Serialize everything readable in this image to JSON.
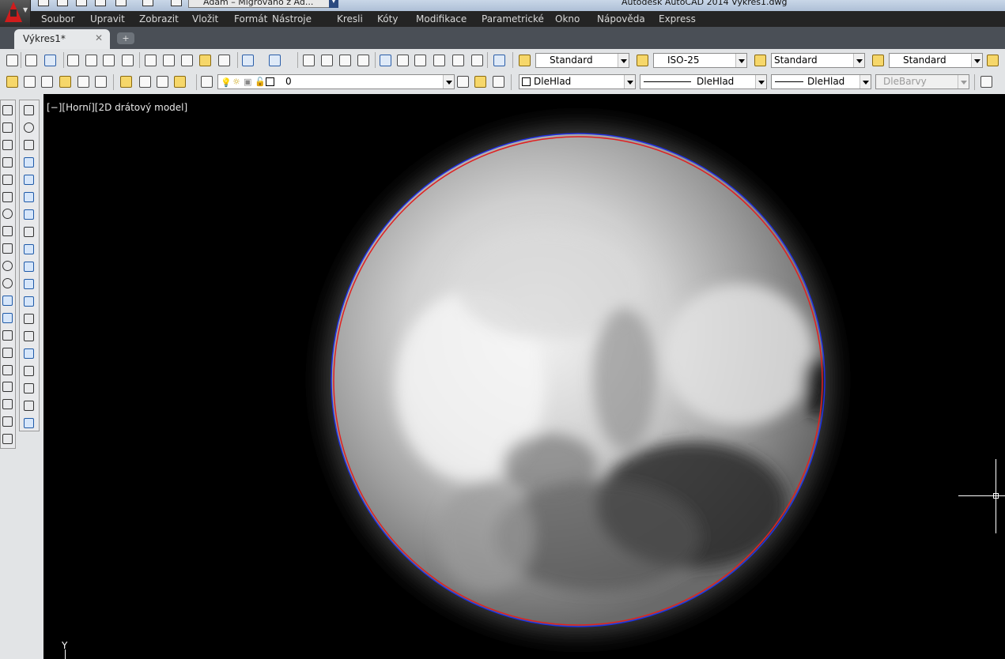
{
  "window": {
    "title": "Autodesk AutoCAD 2014   Výkres1.dwg",
    "workspace": "Adam – Migrováno z Ad..."
  },
  "menu": [
    "Soubor",
    "Upravit",
    "Zobrazit",
    "Vložit",
    "Formát",
    "Nástroje",
    "Kresli",
    "Kóty",
    "Modifikace",
    "Parametrické",
    "Okno",
    "Nápověda",
    "Express"
  ],
  "tabs": [
    {
      "label": "Výkres1*",
      "close": "✕"
    }
  ],
  "new_tab_icon": "+",
  "toolbar_styles": {
    "text_style": "Standard",
    "dim_style": "ISO-25",
    "table_style": "Standard",
    "multileader_style": "Standard"
  },
  "toolbar_layers": {
    "current_layer": "0",
    "color": "DleHlad",
    "linetype": "DleHlad",
    "lineweight": "DleHlad",
    "plot_style": "DleBarvy"
  },
  "viewport": {
    "label": "[−][Horní][2D drátový model]",
    "ucs_axis": "Y"
  },
  "icons": {
    "app": "autocad-a-icon",
    "toolbar1": [
      "new-icon",
      "open-icon",
      "save-icon",
      "plot-icon",
      "plot-preview-icon",
      "publish-icon",
      "3d-print-icon",
      "cut-icon",
      "copy-icon",
      "paste-icon",
      "match-properties-icon",
      "block-editor-icon",
      "undo-icon",
      "redo-icon",
      "pan-icon",
      "zoom-realtime-icon",
      "zoom-window-icon",
      "zoom-previous-icon",
      "properties-icon",
      "design-center-icon",
      "tool-palettes-icon",
      "sheet-set-icon",
      "markup-icon",
      "quickcalc-icon",
      "help-icon"
    ],
    "draw": [
      "line-icon",
      "construction-line-icon",
      "polyline-icon",
      "polygon-icon",
      "rectangle-icon",
      "arc-icon",
      "circle-icon",
      "revision-cloud-icon",
      "spline-icon",
      "ellipse-icon",
      "ellipse-arc-icon",
      "insert-block-icon",
      "make-block-icon",
      "point-icon",
      "hatch-icon",
      "gradient-icon",
      "region-icon",
      "table-icon",
      "mtext-icon",
      "add-selected-icon"
    ],
    "modify": [
      "erase-icon",
      "copy-object-icon",
      "mirror-icon",
      "offset-icon",
      "array-icon",
      "array-path-icon",
      "move-icon",
      "rotate-icon",
      "scale-icon",
      "stretch-icon",
      "trim-icon",
      "extend-icon",
      "break-at-point-icon",
      "break-icon",
      "join-icon",
      "chamfer-icon",
      "fillet-icon",
      "blend-curves-icon",
      "explode-icon"
    ]
  },
  "colors": {
    "viewport_bg": "#000000",
    "circle_red": "#e02020",
    "circle_blue": "#2030e0",
    "menu_bg": "#242424",
    "toolbar_bg": "#e2e4e6"
  }
}
